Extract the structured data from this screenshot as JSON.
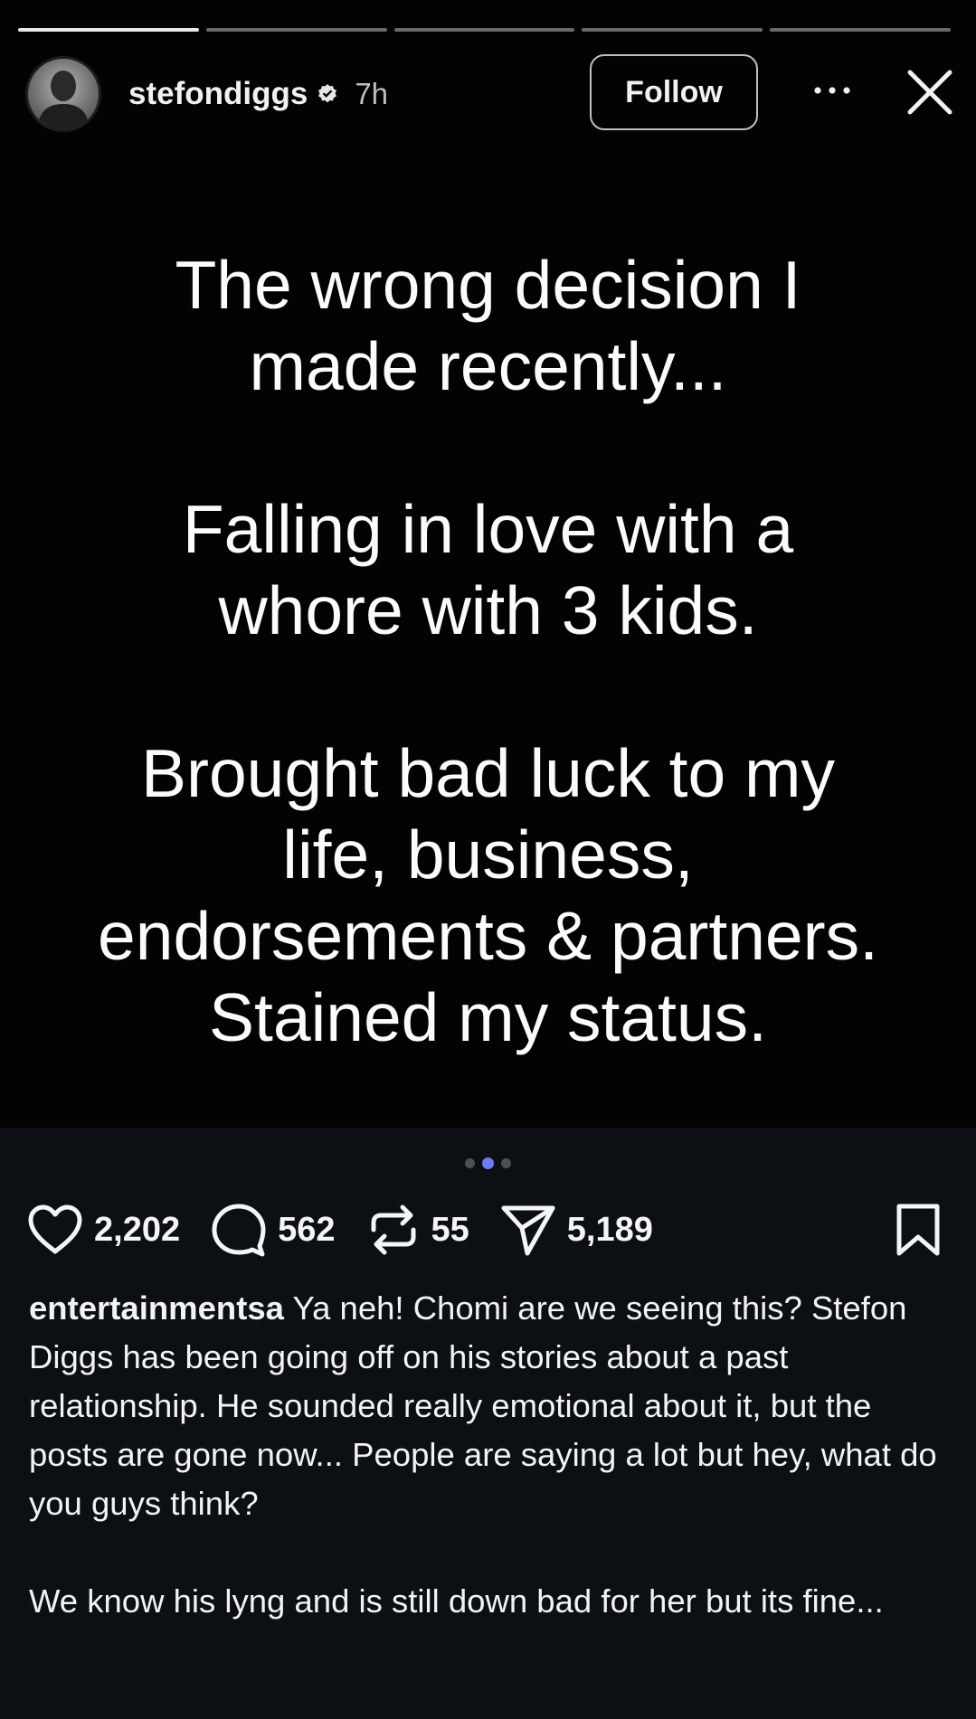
{
  "story": {
    "progress_segments": [
      true,
      false,
      false,
      false,
      false
    ],
    "username": "stefondiggs",
    "time": "7h",
    "follow_label": "Follow",
    "text_blocks": [
      [
        "The wrong decision I",
        "made recently..."
      ],
      [
        "Falling in love with a",
        "whore with 3 kids."
      ],
      [
        "Brought bad luck to my",
        "life, business,",
        "endorsements & partners.",
        "Stained my status."
      ]
    ]
  },
  "carousel": {
    "count": 3,
    "active": 1
  },
  "actions": {
    "likes": "2,202",
    "comments": "562",
    "reposts": "55",
    "shares": "5,189"
  },
  "caption": {
    "handle": "entertainmentsa",
    "text": "Ya neh! Chomi are we seeing this? Stefon Diggs has been going off on his stories about a past relationship. He sounded really emotional about it, but the posts are gone now... People are saying a lot but hey, what do you guys think?",
    "text2": "We know his lyng and is still down bad for her but its fine..."
  },
  "colors": {
    "background": "#0c0f14",
    "story_bg": "#030303",
    "active_dot": "#6f7cf0"
  }
}
